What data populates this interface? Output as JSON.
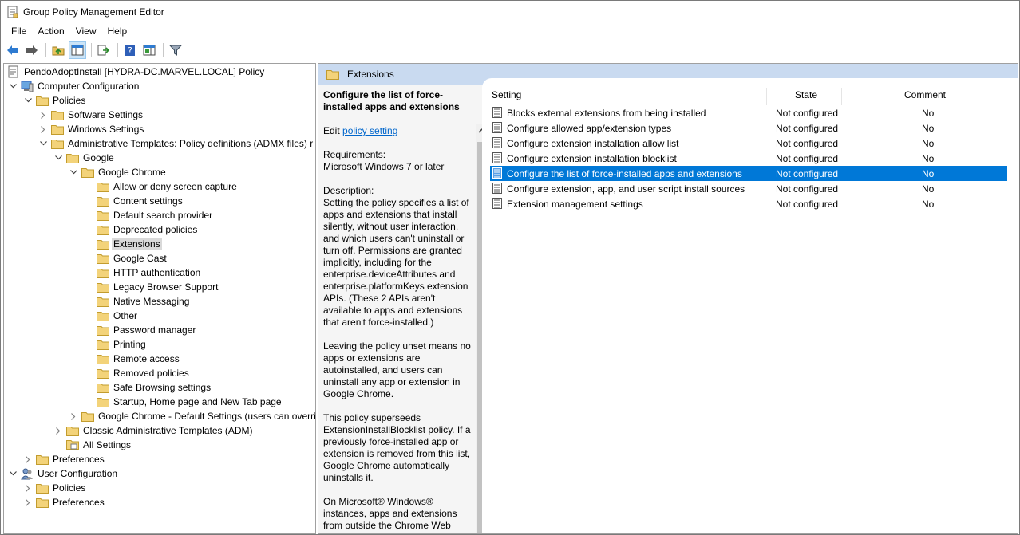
{
  "window": {
    "title": "Group Policy Management Editor"
  },
  "menu": [
    "File",
    "Action",
    "View",
    "Help"
  ],
  "tree": [
    {
      "label": "PendoAdoptInstall [HYDRA-DC.MARVEL.LOCAL] Policy",
      "level": 0,
      "exp": "",
      "icon": "policy-doc"
    },
    {
      "label": "Computer Configuration",
      "level": 0,
      "exp": "down",
      "icon": "computer"
    },
    {
      "label": "Policies",
      "level": 1,
      "exp": "down",
      "icon": "folder"
    },
    {
      "label": "Software Settings",
      "level": 2,
      "exp": "right",
      "icon": "folder"
    },
    {
      "label": "Windows Settings",
      "level": 2,
      "exp": "right",
      "icon": "folder"
    },
    {
      "label": "Administrative Templates: Policy definitions (ADMX files) r",
      "level": 2,
      "exp": "down",
      "icon": "folder"
    },
    {
      "label": "Google",
      "level": 3,
      "exp": "down",
      "icon": "folder"
    },
    {
      "label": "Google Chrome",
      "level": 4,
      "exp": "down",
      "icon": "folder"
    },
    {
      "label": "Allow or deny screen capture",
      "level": 5,
      "exp": "",
      "icon": "folder"
    },
    {
      "label": "Content settings",
      "level": 5,
      "exp": "",
      "icon": "folder"
    },
    {
      "label": "Default search provider",
      "level": 5,
      "exp": "",
      "icon": "folder"
    },
    {
      "label": "Deprecated policies",
      "level": 5,
      "exp": "",
      "icon": "folder"
    },
    {
      "label": "Extensions",
      "level": 5,
      "exp": "",
      "icon": "folder",
      "selected": true
    },
    {
      "label": "Google Cast",
      "level": 5,
      "exp": "",
      "icon": "folder"
    },
    {
      "label": "HTTP authentication",
      "level": 5,
      "exp": "",
      "icon": "folder"
    },
    {
      "label": "Legacy Browser Support",
      "level": 5,
      "exp": "",
      "icon": "folder"
    },
    {
      "label": "Native Messaging",
      "level": 5,
      "exp": "",
      "icon": "folder"
    },
    {
      "label": "Other",
      "level": 5,
      "exp": "",
      "icon": "folder"
    },
    {
      "label": "Password manager",
      "level": 5,
      "exp": "",
      "icon": "folder"
    },
    {
      "label": "Printing",
      "level": 5,
      "exp": "",
      "icon": "folder"
    },
    {
      "label": "Remote access",
      "level": 5,
      "exp": "",
      "icon": "folder"
    },
    {
      "label": "Removed policies",
      "level": 5,
      "exp": "",
      "icon": "folder"
    },
    {
      "label": "Safe Browsing settings",
      "level": 5,
      "exp": "",
      "icon": "folder"
    },
    {
      "label": "Startup, Home page and New Tab page",
      "level": 5,
      "exp": "",
      "icon": "folder"
    },
    {
      "label": "Google Chrome - Default Settings (users can overri",
      "level": 4,
      "exp": "right",
      "icon": "folder"
    },
    {
      "label": "Classic Administrative Templates (ADM)",
      "level": 3,
      "exp": "right",
      "icon": "folder"
    },
    {
      "label": "All Settings",
      "level": 3,
      "exp": "",
      "icon": "all-settings"
    },
    {
      "label": "Preferences",
      "level": 1,
      "exp": "right",
      "icon": "folder"
    },
    {
      "label": "User Configuration",
      "level": 0,
      "exp": "down",
      "icon": "users"
    },
    {
      "label": "Policies",
      "level": 1,
      "exp": "right",
      "icon": "folder"
    },
    {
      "label": "Preferences",
      "level": 1,
      "exp": "right",
      "icon": "folder"
    }
  ],
  "right": {
    "header": "Extensions",
    "description": {
      "title": "Configure the list of force-installed apps and extensions",
      "edit_prefix": "Edit ",
      "edit_link": "policy setting ",
      "requirements_label": "Requirements:",
      "requirements": "Microsoft Windows 7 or later",
      "description_label": "Description:",
      "p1": "Setting the policy specifies a list of apps and extensions that install silently, without user interaction, and which users can't uninstall or turn off. Permissions are granted implicitly, including for the enterprise.deviceAttributes and enterprise.platformKeys extension APIs. (These 2 APIs aren't available to apps and extensions that aren't force-installed.)",
      "p2": "Leaving the policy unset means no apps or extensions are autoinstalled, and users can uninstall any app or extension in Google Chrome.",
      "p3": "This policy superseeds ExtensionInstallBlocklist policy. If a previously force-installed app or extension is removed from this list, Google Chrome automatically uninstalls it.",
      "p4": "On Microsoft® Windows® instances, apps and extensions from outside the Chrome Web"
    },
    "columns": {
      "setting": "Setting",
      "state": "State",
      "comment": "Comment"
    },
    "rows": [
      {
        "setting": "Blocks external extensions from being installed",
        "state": "Not configured",
        "comment": "No"
      },
      {
        "setting": "Configure allowed app/extension types",
        "state": "Not configured",
        "comment": "No"
      },
      {
        "setting": "Configure extension installation allow list",
        "state": "Not configured",
        "comment": "No"
      },
      {
        "setting": "Configure extension installation blocklist",
        "state": "Not configured",
        "comment": "No"
      },
      {
        "setting": "Configure the list of force-installed apps and extensions",
        "state": "Not configured",
        "comment": "No",
        "selected": true
      },
      {
        "setting": "Configure extension, app, and user script install sources",
        "state": "Not configured",
        "comment": "No"
      },
      {
        "setting": "Extension management settings",
        "state": "Not configured",
        "comment": "No"
      }
    ]
  },
  "colors": {
    "selection": "#0078d7",
    "header_bg": "#c9daf0",
    "folder": "#e8c15b"
  }
}
